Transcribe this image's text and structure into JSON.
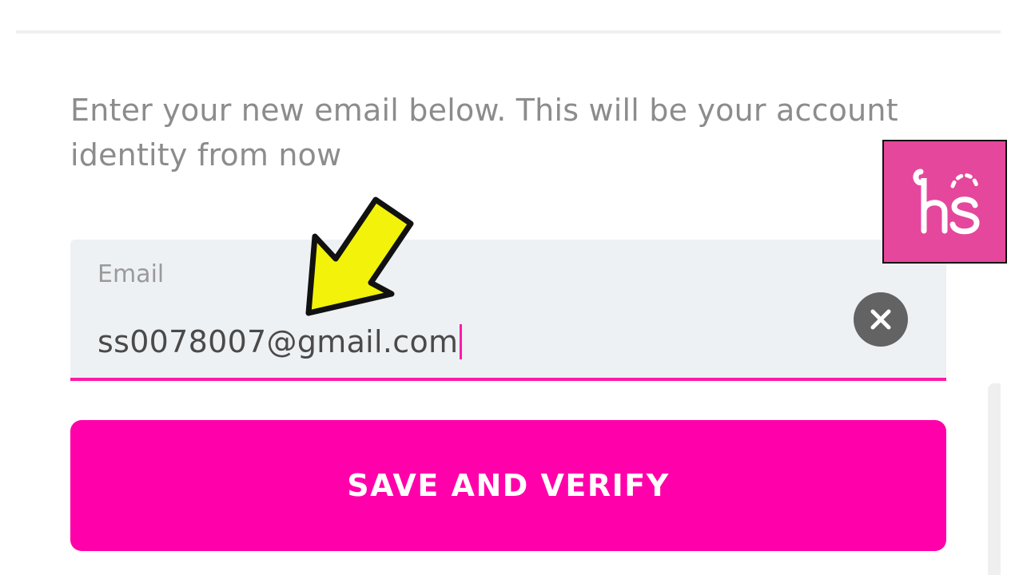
{
  "instructions": "Enter your new email below. This will be your account identity from now",
  "email_field": {
    "label": "Email",
    "value": "ss0078007@gmail.com",
    "clear_icon": "close-icon"
  },
  "save_button": {
    "label": "SAVE AND VERIFY"
  },
  "colors": {
    "accent": "#ff00aa",
    "field_background": "#eef1f4",
    "logo_background": "#e5479c",
    "annotation_arrow": "#f2f20a"
  },
  "icons": {
    "logo": "hs-logo",
    "annotation": "arrow-pointer-icon"
  }
}
